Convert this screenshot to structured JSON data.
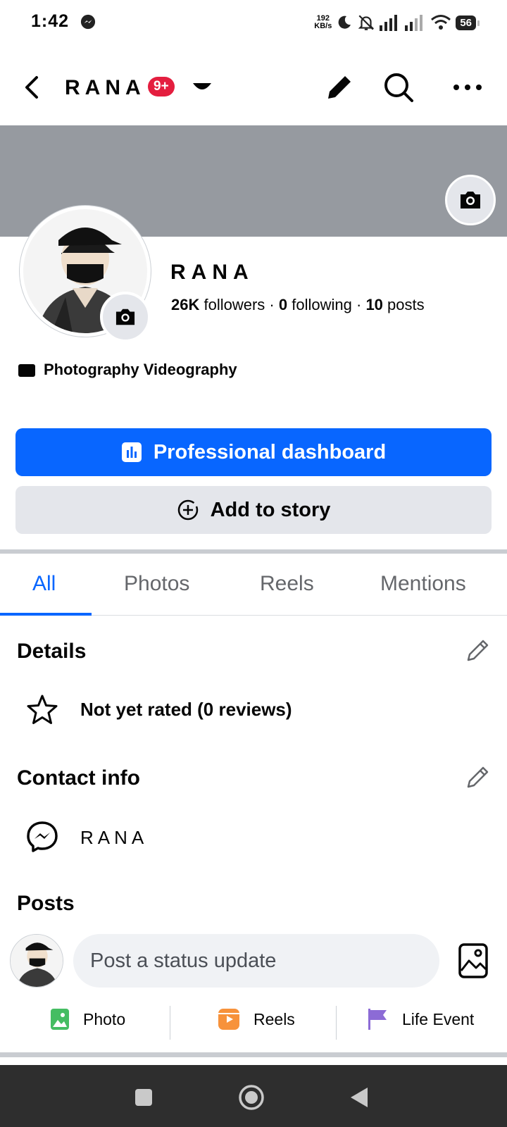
{
  "status_bar": {
    "time": "1:42",
    "net_speed_value": "192",
    "net_speed_unit": "KB/s",
    "battery": "56"
  },
  "header": {
    "title": "RANA",
    "notification_badge": "9+"
  },
  "profile": {
    "name": "RANA",
    "followers_count": "26K",
    "followers_label": "followers",
    "following_count": "0",
    "following_label": "following",
    "posts_count": "10",
    "posts_label": "posts",
    "category": "Photography Videography"
  },
  "buttons": {
    "primary": "Professional dashboard",
    "secondary": "Add to story"
  },
  "tabs": [
    {
      "label": "All",
      "active": true
    },
    {
      "label": "Photos",
      "active": false
    },
    {
      "label": "Reels",
      "active": false
    },
    {
      "label": "Mentions",
      "active": false
    }
  ],
  "details": {
    "title": "Details",
    "rating": "Not yet rated (0 reviews)"
  },
  "contact": {
    "title": "Contact info",
    "messenger": "RANA"
  },
  "posts": {
    "title": "Posts",
    "placeholder": "Post a status update",
    "actions": [
      "Photo",
      "Reels",
      "Life Event"
    ]
  },
  "colors": {
    "accent": "#0866ff",
    "badge": "#e41e3f",
    "cover": "#969aa0",
    "secondary_button": "#e4e6eb"
  },
  "icons": {
    "back": "arrow-left-icon",
    "dropdown": "caret-down-icon",
    "edit": "pencil-icon",
    "search": "search-icon",
    "more": "more-horizontal-icon",
    "camera": "camera-icon",
    "category": "clapperboard-icon",
    "dashboard": "bar-chart-icon",
    "add_story": "plus-circle-icon",
    "rating": "star-icon",
    "contact": "messenger-icon",
    "gallery": "gallery-icon",
    "photo": "photo-icon",
    "reels": "reels-icon",
    "life_event": "flag-icon"
  }
}
